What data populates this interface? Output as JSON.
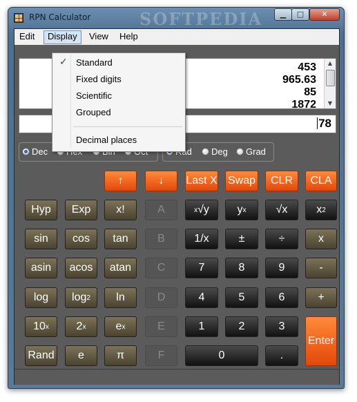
{
  "window": {
    "title": "RPN Calculator",
    "watermark": "SOFTPEDIA",
    "minimize_icon": "minimize-icon",
    "maximize_icon": "maximize-icon",
    "close_icon": "close-icon"
  },
  "menubar": {
    "edit": "Edit",
    "display": "Display",
    "view": "View",
    "help": "Help"
  },
  "display_menu": {
    "checked": "Standard",
    "check_glyph": "✓",
    "items": [
      "Standard",
      "Fixed digits",
      "Scientific",
      "Grouped",
      "Decimal places"
    ]
  },
  "stack": {
    "values": [
      "453",
      "965.63",
      "85",
      "1872"
    ]
  },
  "entry": {
    "value": "78"
  },
  "number_base": {
    "options": [
      "Dec",
      "Hex",
      "Bin",
      "Oct"
    ],
    "selected": "Dec"
  },
  "angle_mode": {
    "options": [
      "Rad",
      "Deg",
      "Grad"
    ],
    "selected": "Rad"
  },
  "keys": {
    "up": "↑",
    "down": "↓",
    "lastx": "Last X",
    "swap": "Swap",
    "clr": "CLR",
    "cla": "CLA",
    "hyp": "Hyp",
    "exp": "Exp",
    "fact": "x!",
    "A": "A",
    "xrooty_base": "√y",
    "xrooty_sup": "x",
    "ypow_base": "y",
    "ypow_sup": "x",
    "sqrt": "√x",
    "sq_base": "x",
    "sq_sup": "2",
    "sin": "sin",
    "cos": "cos",
    "tan": "tan",
    "B": "B",
    "recip": "1/x",
    "chs": "±",
    "div": "÷",
    "mul": "x",
    "asin": "asin",
    "acos": "acos",
    "atan": "atan",
    "C": "C",
    "d7": "7",
    "d8": "8",
    "d9": "9",
    "sub": "-",
    "log": "log",
    "log2_base": "log",
    "log2_sub": "2",
    "ln": "ln",
    "D": "D",
    "d4": "4",
    "d5": "5",
    "d6": "6",
    "add": "+",
    "tenx_base": "10",
    "tenx_sup": "x",
    "twox_base": "2",
    "twox_sup": "x",
    "ex_base": "e",
    "ex_sup": "x",
    "E": "E",
    "d1": "1",
    "d2": "2",
    "d3": "3",
    "enter": "Enter",
    "rand": "Rand",
    "e": "e",
    "pi": "π",
    "F": "F",
    "d0": "0",
    "dot": "."
  }
}
